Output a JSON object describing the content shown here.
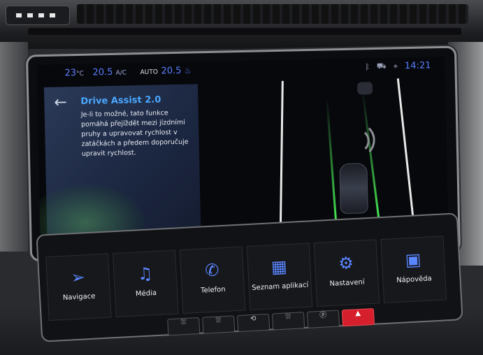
{
  "status_bar": {
    "outside_temp": "23",
    "outside_unit": "°C",
    "left_temp": "20.5",
    "ac_label": "A/C",
    "auto_label": "AUTO",
    "right_temp": "20.5",
    "seat_heat_icon": "seat-heat-icon",
    "bluetooth_icon": "bluetooth-icon",
    "car_icon": "car-icon",
    "location_icon": "location-icon",
    "time": "14:21"
  },
  "info_panel": {
    "title": "Drive Assist 2.0",
    "text": "Je-li to možné, tato funkce pomáhá přejíždět mezi jízdními pruhy a upravovat rychlost v zatáčkách a předem doporučuje upravit rychlost."
  },
  "touchbar": {
    "buttons": [
      {
        "label": "Navigace",
        "icon": "navigation-arrow-icon"
      },
      {
        "label": "Média",
        "icon": "music-note-icon"
      },
      {
        "label": "Telefon",
        "icon": "phone-icon"
      },
      {
        "label": "Seznam aplikací",
        "icon": "app-grid-icon"
      },
      {
        "label": "Nastavení",
        "icon": "gear-icon"
      },
      {
        "label": "Nápověda",
        "icon": "help-book-icon"
      }
    ]
  },
  "hardware_buttons": [
    {
      "icon": "rear-defrost-icon",
      "symbol": "⛆"
    },
    {
      "icon": "front-defrost-icon",
      "symbol": "⛆"
    },
    {
      "icon": "recirculation-icon",
      "symbol": "⟲"
    },
    {
      "icon": "heated-screen-icon",
      "symbol": "⛆"
    },
    {
      "icon": "parking-icon",
      "symbol": "ⓟ"
    },
    {
      "icon": "hazard-icon",
      "symbol": "▲"
    }
  ],
  "colors": {
    "accent": "#5a7fff",
    "title_blue": "#4aa8ff",
    "lane_green": "#4cff5a",
    "hazard_red": "#d61f2c"
  }
}
